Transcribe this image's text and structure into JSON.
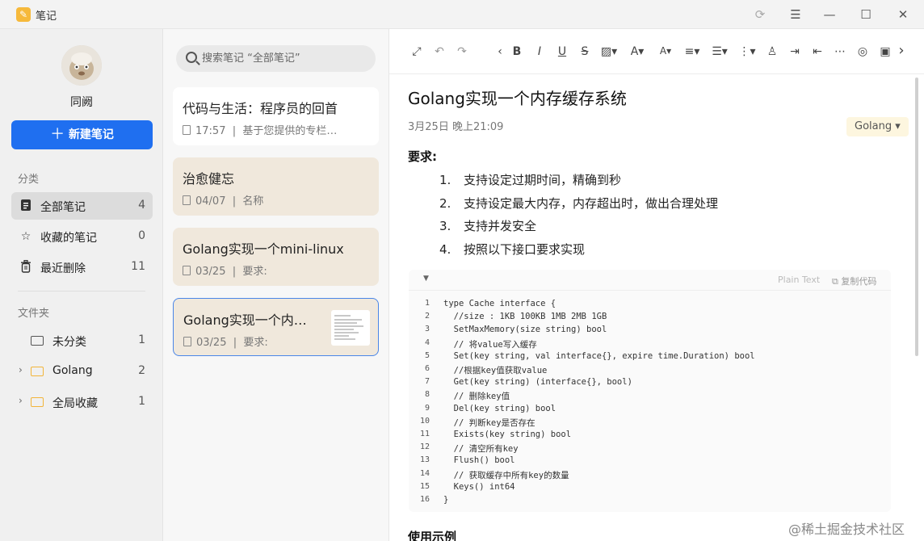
{
  "window": {
    "app_title": "笔记",
    "controls": [
      "sync-icon",
      "menu-icon",
      "minimize-icon",
      "maximize-icon",
      "close-icon"
    ]
  },
  "sidebar": {
    "user_name": "同阙",
    "new_note_label": "新建笔记",
    "category_label": "分类",
    "categories": [
      {
        "label": "全部笔记",
        "count": "4",
        "icon": "document-icon"
      },
      {
        "label": "收藏的笔记",
        "count": "0",
        "icon": "star-icon"
      },
      {
        "label": "最近删除",
        "count": "11",
        "icon": "trash-icon"
      }
    ],
    "folders_label": "文件夹",
    "folders": [
      {
        "label": "未分类",
        "count": "1"
      },
      {
        "label": "Golang",
        "count": "2"
      },
      {
        "label": "全局收藏",
        "count": "1"
      }
    ]
  },
  "notelist": {
    "search_placeholder": "搜索笔记 “全部笔记”",
    "notes": [
      {
        "title": "代码与生活：程序员的回首",
        "time": "17:57",
        "sep": "|",
        "preview": "基于您提供的专栏…"
      },
      {
        "title": "治愈健忘",
        "time": "04/07",
        "sep": "|",
        "preview": "名称"
      },
      {
        "title": "Golang实现一个mini-linux",
        "time": "03/25",
        "sep": "|",
        "preview": "要求:"
      },
      {
        "title": "Golang实现一个内…",
        "time": "03/25",
        "sep": "|",
        "preview": "要求:"
      }
    ]
  },
  "editor": {
    "title": "Golang实现一个内存缓存系统",
    "date": "3月25日 晚上21:09",
    "tag": "Golang ▾",
    "req_label": "要求:",
    "requirements": [
      {
        "num": "1.",
        "text": "支持设定过期时间，精确到秒"
      },
      {
        "num": "2.",
        "text": "支持设定最大内存，内存超出时，做出合理处理"
      },
      {
        "num": "3.",
        "text": "支持并发安全"
      },
      {
        "num": "4.",
        "text": "按照以下接口要求实现"
      }
    ],
    "code": {
      "language": "Plain Text",
      "copy_label": "复制代码",
      "lines": [
        "type Cache interface {",
        "  //size : 1KB 100KB 1MB 2MB 1GB",
        "  SetMaxMemory(size string) bool",
        "  // 将value写入缓存",
        "  Set(key string, val interface{}, expire time.Duration) bool",
        "  //根据key值获取value",
        "  Get(key string) (interface{}, bool)",
        "  // 删除key值",
        "  Del(key string) bool",
        "  // 判断key是否存在",
        "  Exists(key string) bool",
        "  // 清空所有key",
        "  Flush() bool",
        "  // 获取缓存中所有key的数量",
        "  Keys() int64",
        "}"
      ]
    },
    "next_heading": "使用示例"
  },
  "watermark": "@稀土掘金技术社区"
}
